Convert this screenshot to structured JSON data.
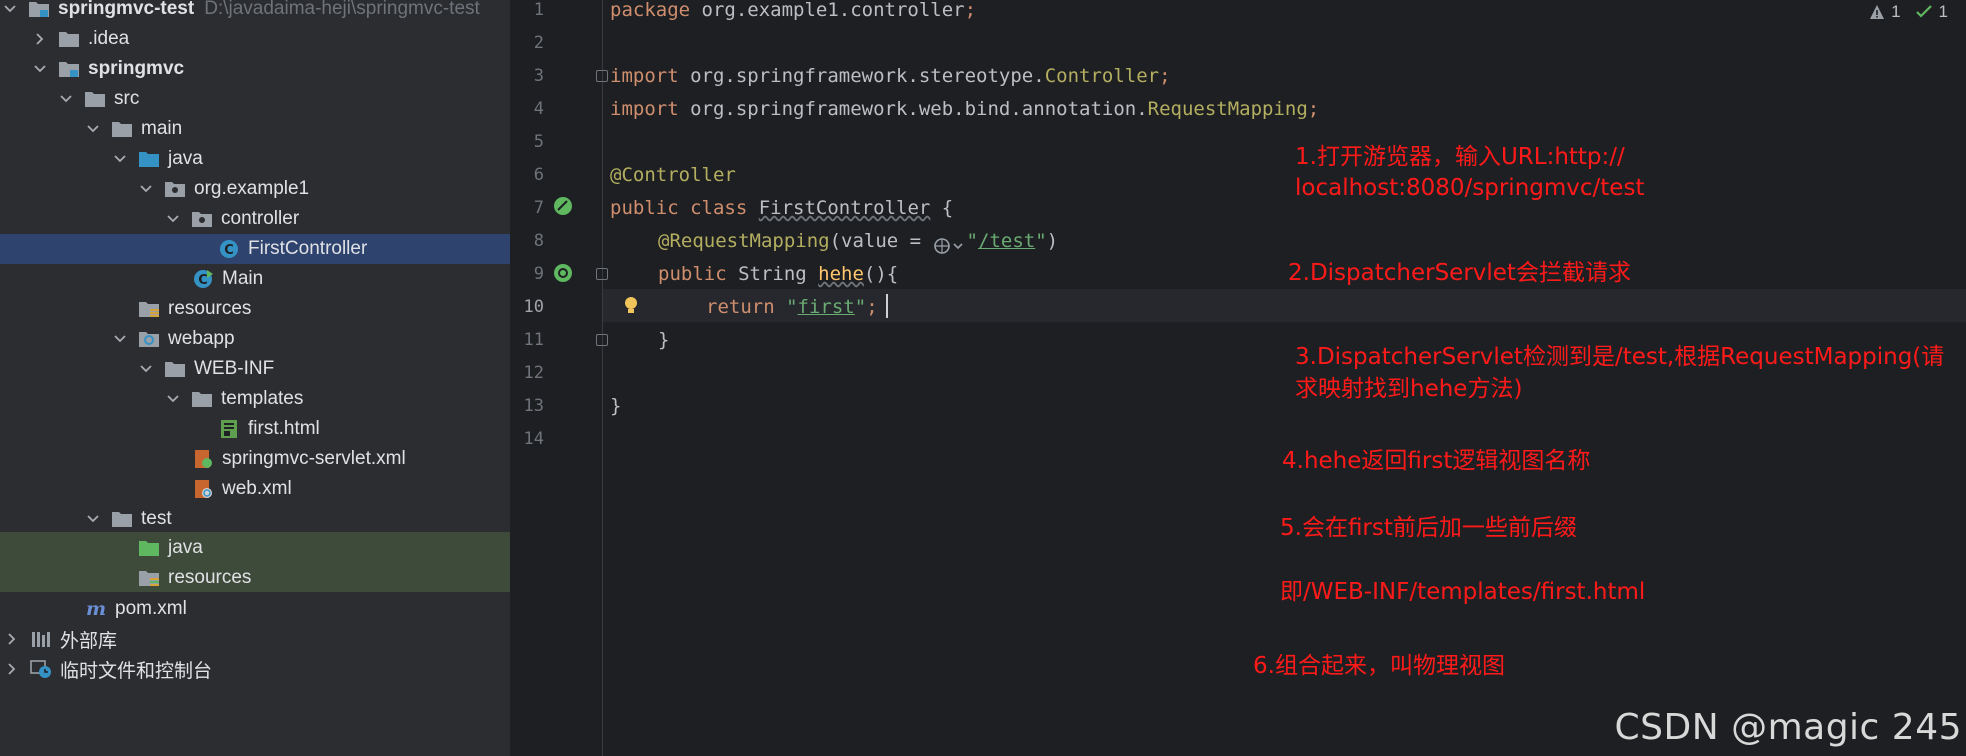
{
  "project": {
    "name": "springmvc-test",
    "path": "D:\\javadaima-heji\\springmvc-test"
  },
  "tree": [
    {
      "label": "springmvc-test",
      "path": "D:\\javadaima-heji\\springmvc-test"
    },
    {
      "label": ".idea"
    },
    {
      "label": "springmvc"
    },
    {
      "label": "src"
    },
    {
      "label": "main"
    },
    {
      "label": "java"
    },
    {
      "label": "org.example1"
    },
    {
      "label": "controller"
    },
    {
      "label": "FirstController"
    },
    {
      "label": "Main"
    },
    {
      "label": "resources"
    },
    {
      "label": "webapp"
    },
    {
      "label": "WEB-INF"
    },
    {
      "label": "templates"
    },
    {
      "label": "first.html"
    },
    {
      "label": "springmvc-servlet.xml"
    },
    {
      "label": "web.xml"
    },
    {
      "label": "test"
    },
    {
      "label": "java"
    },
    {
      "label": "resources"
    },
    {
      "label": "pom.xml"
    },
    {
      "label": "外部库"
    },
    {
      "label": "临时文件和控制台"
    }
  ],
  "editor": {
    "line_numbers": [
      "1",
      "2",
      "3",
      "4",
      "5",
      "6",
      "7",
      "8",
      "9",
      "10",
      "11",
      "12",
      "13",
      "14"
    ],
    "current_line": "10",
    "inspections": {
      "warnings": "1",
      "ok": "1"
    }
  },
  "code": {
    "l1": {
      "kw": "package",
      "rest": " org.example1.controller",
      "semi": ";"
    },
    "l3": {
      "kw": "import",
      "rest": " org.springframework.stereotype.",
      "cls": "Controller",
      "semi": ";"
    },
    "l4": {
      "kw": "import",
      "rest": " org.springframework.web.bind.annotation.",
      "cls": "RequestMapping",
      "semi": ";"
    },
    "l6": {
      "ann": "@Controller"
    },
    "l7": {
      "kw": "public class",
      "name": "FirstController",
      "rest": " {"
    },
    "l8": {
      "ann": "@RequestMapping",
      "open": "(value = ",
      "str_q1": "\"",
      "str": "/test",
      "str_q2": "\"",
      "close": ")"
    },
    "l9": {
      "kw": "public",
      "type": " String ",
      "name": "hehe",
      "rest": "(){"
    },
    "l10": {
      "kw": "return",
      "str_q1": "\"",
      "str": "first",
      "str_q2": "\"",
      "semi": ";"
    },
    "l11": {
      "rest": "}"
    },
    "l13": {
      "rest": "}"
    }
  },
  "notes": {
    "n1a": "1.打开游览器，输入URL:http://",
    "n1b": "localhost:8080/springmvc/test",
    "n2": "2.DispatcherServlet会拦截请求",
    "n3a": "3.DispatcherServlet检测到是/test,根据RequestMapping(请",
    "n3b": "求映射找到hehe方法)",
    "n4": "4.hehe返回first逻辑视图名称",
    "n5": "5.会在first前后加一些前后缀",
    "n5b": "即/WEB-INF/templates/first.html",
    "n6": "6.组合起来，叫物理视图"
  },
  "watermark": "CSDN @magic 245",
  "colors": {
    "annotation_red": "#ff1a1a",
    "keyword": "#cf8e6d",
    "string": "#6aab73",
    "annotation": "#b3ae60",
    "selection": "#2e436e"
  }
}
